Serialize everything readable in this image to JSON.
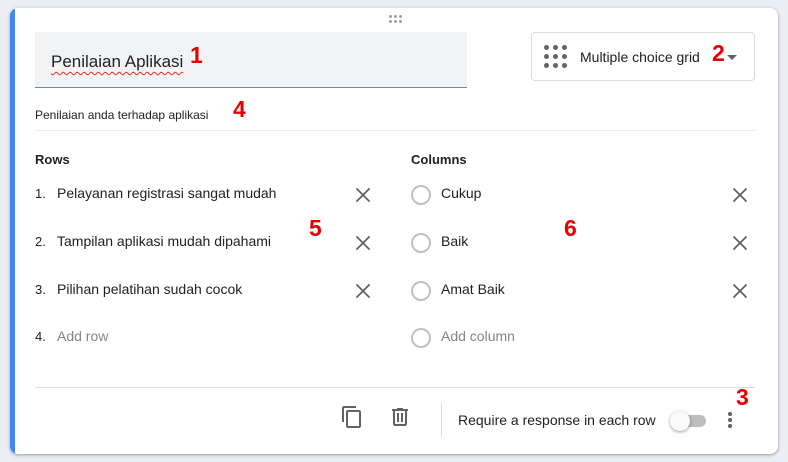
{
  "question": {
    "title": "Penilaian Aplikasi",
    "description": "Penilaian anda terhadap aplikasi",
    "type_label": "Multiple choice grid"
  },
  "rows": {
    "heading": "Rows",
    "items": [
      {
        "num": "1.",
        "label": "Pelayanan registrasi sangat mudah"
      },
      {
        "num": "2.",
        "label": "Tampilan aplikasi mudah dipahami"
      },
      {
        "num": "3.",
        "label": "Pilihan pelatihan sudah cocok"
      }
    ],
    "add": {
      "num": "4.",
      "label": "Add row"
    }
  },
  "columns": {
    "heading": "Columns",
    "items": [
      {
        "label": "Cukup"
      },
      {
        "label": "Baik"
      },
      {
        "label": "Amat Baik"
      }
    ],
    "add": {
      "label": "Add column"
    }
  },
  "footer": {
    "require_label": "Require a response in each row",
    "require_on": false
  },
  "markers": [
    "1",
    "2",
    "3",
    "4",
    "5",
    "6"
  ],
  "colors": {
    "accent": "#4285f4",
    "marker": "#e80000",
    "spellcheck": "#d93025"
  },
  "icons": [
    "drag-handle-icon",
    "grid-icon",
    "dropdown-arrow-icon",
    "close-icon",
    "duplicate-icon",
    "delete-icon",
    "more-vert-icon"
  ]
}
